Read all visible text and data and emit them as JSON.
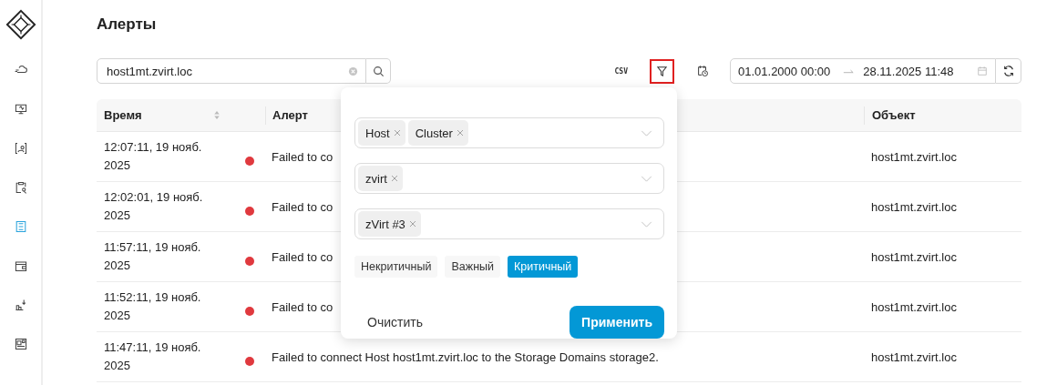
{
  "nav": [
    {
      "selected": false
    },
    {
      "selected": false
    },
    {
      "selected": false
    },
    {
      "selected": false
    },
    {
      "selected": true
    },
    {
      "selected": false
    },
    {
      "selected": false
    },
    {
      "selected": false
    }
  ],
  "title": "Алерты",
  "search": {
    "value": "host1mt.zvirt.loc"
  },
  "toolbar": {
    "csv": "CSV",
    "filter_active": true
  },
  "date_range": {
    "from": "01.01.2000 00:00",
    "to": "28.11.2025 11:48"
  },
  "table": {
    "columns": [
      "Время",
      "Алерт",
      "Объект"
    ],
    "rows": [
      {
        "time": "12:07:11, 19 нояб. 2025",
        "color": "#e0393e",
        "alert": "Failed to co",
        "object": "host1mt.zvirt.loc"
      },
      {
        "time": "12:02:01, 19 нояб. 2025",
        "color": "#e0393e",
        "alert": "Failed to co",
        "object": "host1mt.zvirt.loc"
      },
      {
        "time": "11:57:11, 19 нояб. 2025",
        "color": "#e0393e",
        "alert": "Failed to co",
        "object": "host1mt.zvirt.loc"
      },
      {
        "time": "11:52:11, 19 нояб. 2025",
        "color": "#e0393e",
        "alert": "Failed to co",
        "object": "host1mt.zvirt.loc"
      },
      {
        "time": "11:47:11, 19 нояб. 2025",
        "color": "#e0393e",
        "alert": "Failed to connect Host host1mt.zvirt.loc to the Storage Domains storage2.",
        "object": "host1mt.zvirt.loc"
      }
    ]
  },
  "filter_popup": {
    "selects": [
      {
        "tags": [
          "Host",
          "Cluster"
        ]
      },
      {
        "tags": [
          "zvirt"
        ]
      },
      {
        "tags": [
          "zVirt #3"
        ]
      }
    ],
    "severities": [
      {
        "label": "Некритичный",
        "selected": false
      },
      {
        "label": "Важный",
        "selected": false
      },
      {
        "label": "Критичный",
        "selected": true
      }
    ],
    "clear": "Очистить",
    "apply": "Применить"
  }
}
